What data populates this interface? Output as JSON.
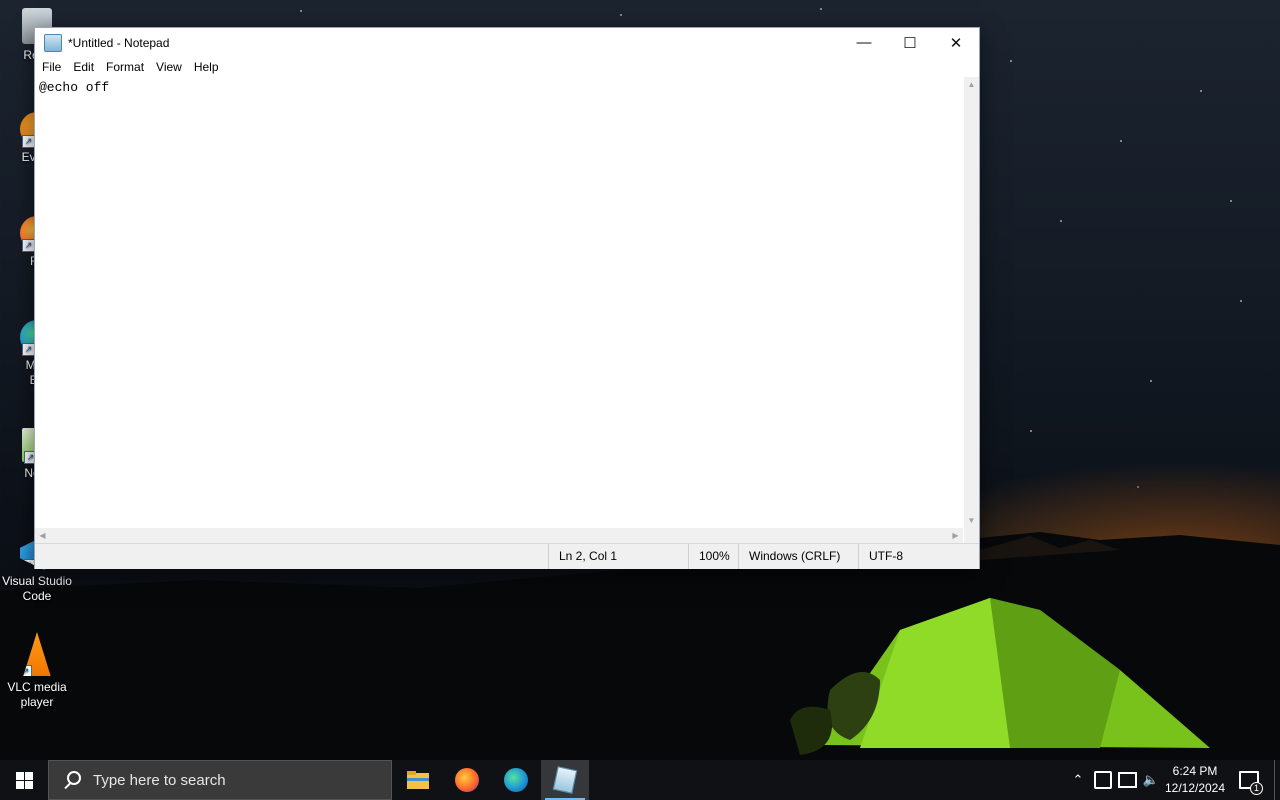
{
  "desktop": {
    "icons": [
      {
        "label": "Recy",
        "icon": "recycle-bin-icon"
      },
      {
        "label": "Every",
        "icon": "everything-icon"
      },
      {
        "label": "Fir",
        "icon": "firefox-icon"
      },
      {
        "label": "Micr",
        "label2": "Ed",
        "icon": "edge-icon"
      },
      {
        "label": "Note",
        "icon": "notepadpp-icon"
      },
      {
        "label": "Visual Studio",
        "label2": "Code",
        "icon": "vscode-icon"
      },
      {
        "label": "VLC media",
        "label2": "player",
        "icon": "vlc-icon"
      }
    ]
  },
  "notepad": {
    "title": "*Untitled - Notepad",
    "controls": {
      "minimize": "—",
      "maximize": "☐",
      "close": "✕"
    },
    "menu": [
      "File",
      "Edit",
      "Format",
      "View",
      "Help"
    ],
    "content": "@echo off\n",
    "status": {
      "position": "Ln 2, Col 1",
      "zoom": "100%",
      "line_endings": "Windows (CRLF)",
      "encoding": "UTF-8"
    }
  },
  "taskbar": {
    "search_placeholder": "Type here to search",
    "pinned": [
      "file-explorer-icon",
      "firefox-icon",
      "edge-icon",
      "notepad-icon"
    ],
    "active_app": "notepad",
    "tray": {
      "time": "6:24 PM",
      "date": "12/12/2024",
      "notification_count": "1"
    }
  }
}
